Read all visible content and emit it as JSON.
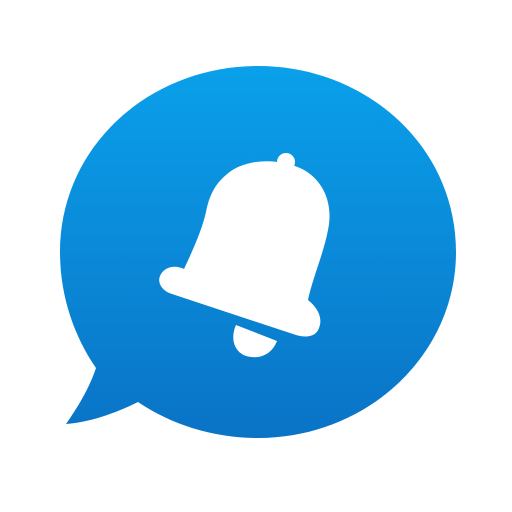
{
  "app_icon": {
    "icon": "chat-bubble-bell-icon",
    "colors": {
      "background": "#ffffff",
      "bubble_top": "#0aa0ea",
      "bubble_bottom": "#0a73c6",
      "glyph": "#ffffff"
    }
  }
}
